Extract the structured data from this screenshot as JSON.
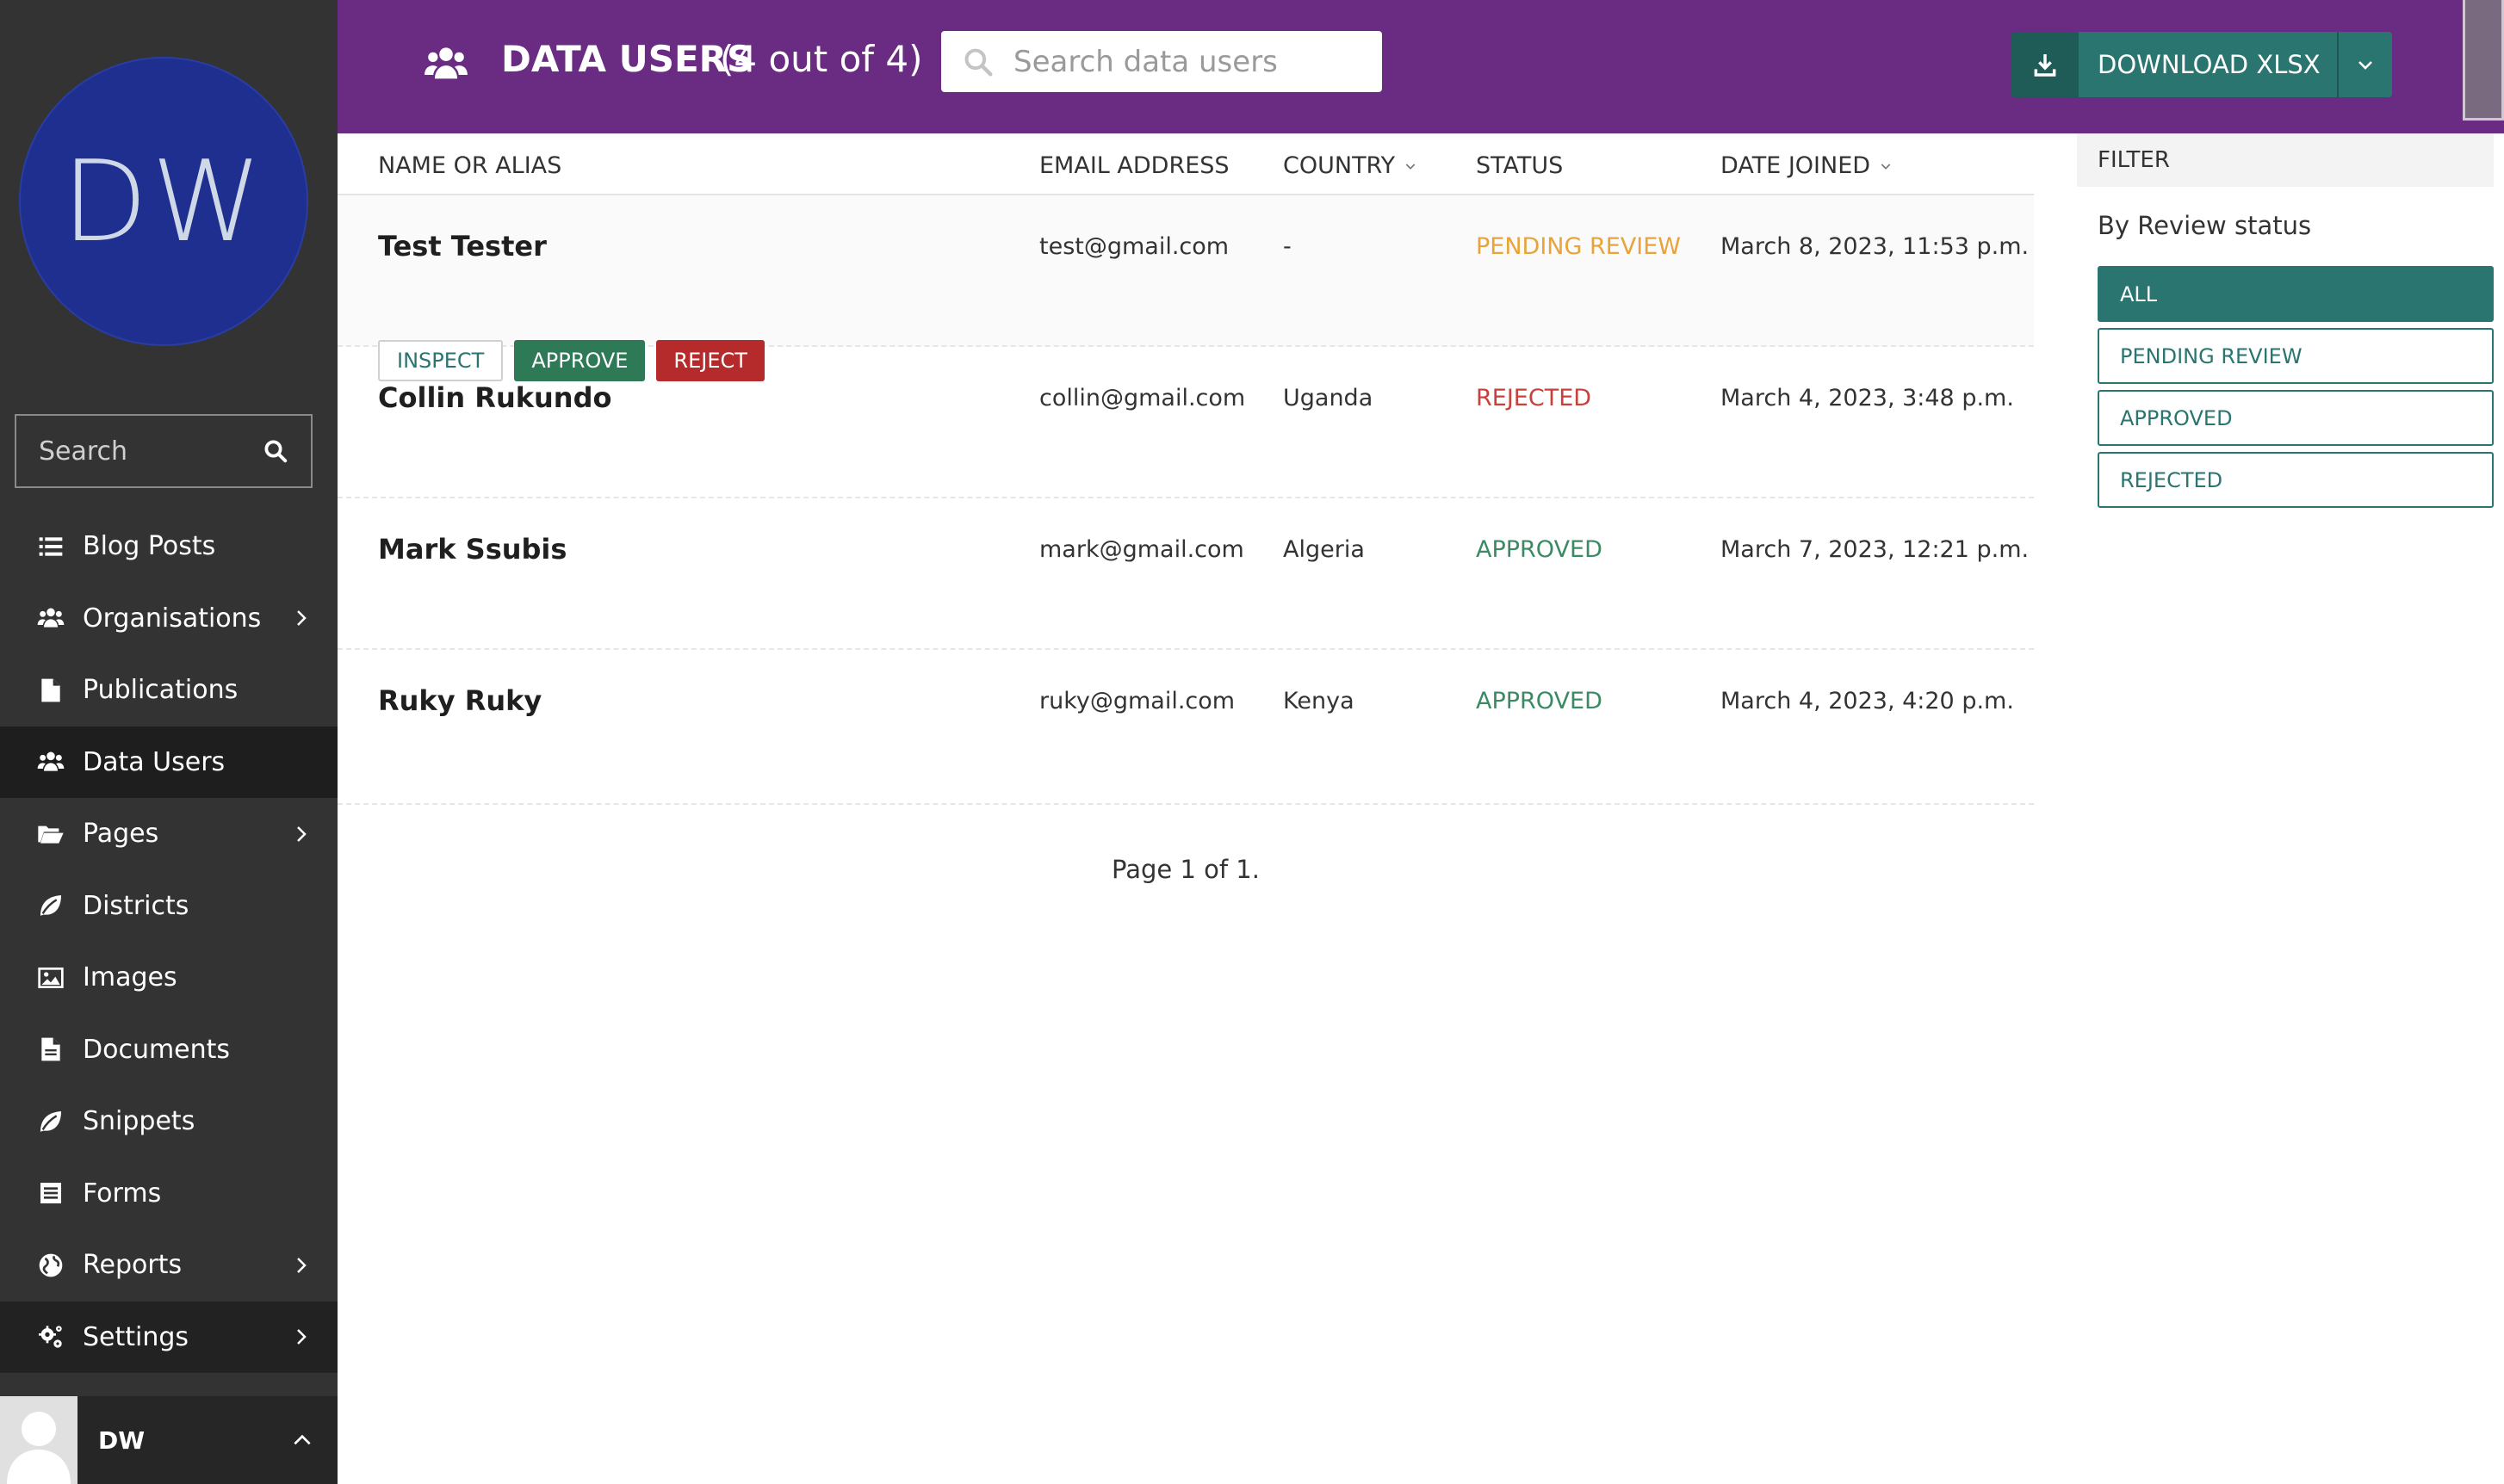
{
  "sidebar": {
    "logo_text": "DW",
    "search_label": "Search",
    "items": [
      {
        "label": "Blog Posts",
        "icon": "list-icon",
        "has_children": false
      },
      {
        "label": "Organisations",
        "icon": "group-icon",
        "has_children": true
      },
      {
        "label": "Publications",
        "icon": "doc-icon",
        "has_children": false
      },
      {
        "label": "Data Users",
        "icon": "group-icon",
        "has_children": false,
        "active": true
      },
      {
        "label": "Pages",
        "icon": "folder-open-icon",
        "has_children": true
      },
      {
        "label": "Districts",
        "icon": "leaf-icon",
        "has_children": false
      },
      {
        "label": "Images",
        "icon": "image-icon",
        "has_children": false
      },
      {
        "label": "Documents",
        "icon": "doc-full-icon",
        "has_children": false
      },
      {
        "label": "Snippets",
        "icon": "leaf-icon",
        "has_children": false
      },
      {
        "label": "Forms",
        "icon": "form-icon",
        "has_children": false
      },
      {
        "label": "Reports",
        "icon": "globe-icon",
        "has_children": true
      },
      {
        "label": "Settings",
        "icon": "cogs-icon",
        "has_children": true
      }
    ],
    "account_name": "DW"
  },
  "header": {
    "title": "DATA USERS",
    "count": "(4 out of 4)",
    "search_placeholder": "Search data users",
    "download_label": "DOWNLOAD XLSX"
  },
  "table": {
    "columns": [
      "NAME OR ALIAS",
      "EMAIL ADDRESS",
      "COUNTRY",
      "STATUS",
      "DATE JOINED"
    ],
    "rows": [
      {
        "name": "Test Tester",
        "email": "test@gmail.com",
        "country": "-",
        "status": "PENDING REVIEW",
        "date": "March 8, 2023, 11:53 p.m."
      },
      {
        "name": "Collin Rukundo",
        "email": "collin@gmail.com",
        "country": "Uganda",
        "status": "REJECTED",
        "date": "March 4, 2023, 3:48 p.m."
      },
      {
        "name": "Mark Ssubis",
        "email": "mark@gmail.com",
        "country": "Algeria",
        "status": "APPROVED",
        "date": "March 7, 2023, 12:21 p.m."
      },
      {
        "name": "Ruky Ruky",
        "email": "ruky@gmail.com",
        "country": "Kenya",
        "status": "APPROVED",
        "date": "March 4, 2023, 4:20 p.m."
      }
    ],
    "row_actions": {
      "inspect": "INSPECT",
      "approve": "APPROVE",
      "reject": "REJECT"
    },
    "pagination": "Page 1 of 1."
  },
  "filter": {
    "title": "FILTER",
    "subtitle": "By Review status",
    "options": [
      "ALL",
      "PENDING REVIEW",
      "APPROVED",
      "REJECTED"
    ],
    "selected": "ALL"
  },
  "colors": {
    "header_bg": "#6a2c83",
    "sidebar_bg": "#333333",
    "accent_teal": "#2a7570",
    "pending": "#e8a43a",
    "rejected": "#c8413b",
    "approved": "#3c8a63"
  }
}
